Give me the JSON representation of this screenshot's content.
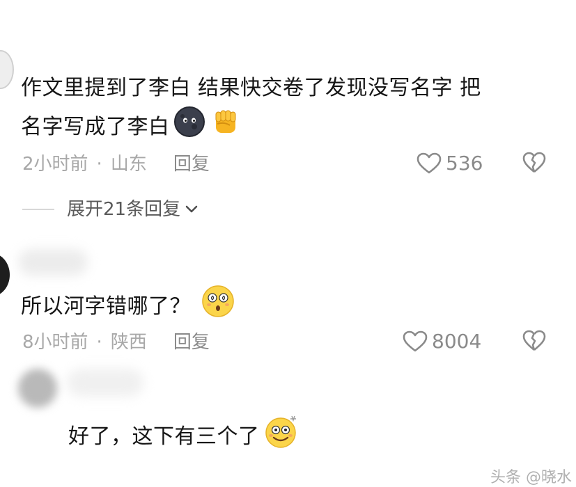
{
  "comments": [
    {
      "text_line1": "作文里提到了李白 结果快交卷了发现没写名字 把",
      "text_line2": "名字写成了李白",
      "time": "2小时前",
      "location": "山东",
      "reply_label": "回复",
      "likes": "536",
      "icons": [
        "dark-moon-emoji-icon",
        "raised-fist-emoji-icon"
      ]
    },
    {
      "text": "所以河字错哪了？",
      "time": "8小时前",
      "location": "陕西",
      "reply_label": "回复",
      "likes": "8004",
      "icons": [
        "dizzy-face-emoji-icon"
      ]
    },
    {
      "text": "好了，这下有三个了",
      "icons": [
        "sweat-smile-emoji-icon"
      ]
    }
  ],
  "expand_replies": "展开21条回复",
  "separator": "·",
  "watermark": "头条 @晓水",
  "colors": {
    "meta": "#a8a8a8",
    "text": "#161616",
    "icon": "#8a8a8a"
  }
}
